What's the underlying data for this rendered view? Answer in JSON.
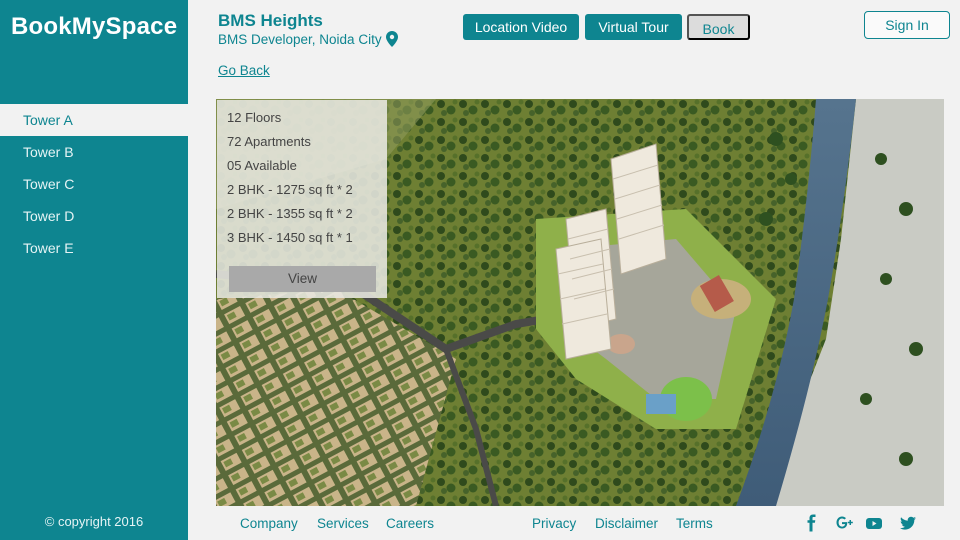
{
  "brand": "BookMySpace",
  "sidebar": {
    "items": [
      {
        "label": "Tower A"
      },
      {
        "label": "Tower B"
      },
      {
        "label": "Tower C"
      },
      {
        "label": "Tower D"
      },
      {
        "label": "Tower E"
      }
    ],
    "active_index": 0,
    "copyright": "© copyright 2016"
  },
  "header": {
    "project_name": "BMS Heights",
    "developer": "BMS Developer, Noida City",
    "location_icon": "map-pin-icon",
    "go_back": "Go Back",
    "buttons": {
      "location_video": "Location Video",
      "virtual_tour": "Virtual Tour",
      "book": "Book",
      "sign_in": "Sign In"
    }
  },
  "tower_info": {
    "floors": "12 Floors",
    "apartments": "72 Apartments",
    "available": "05 Available",
    "units": [
      "2 BHK - 1275 sq ft * 2",
      "2 BHK - 1355 sq ft * 2",
      "3 BHK - 1450 sq ft * 1"
    ],
    "view_button": "View"
  },
  "footer": {
    "left_links": [
      "Company",
      "Services",
      "Careers"
    ],
    "right_links": [
      "Privacy",
      "Disclaimer",
      "Terms"
    ],
    "social_icons": [
      "facebook-icon",
      "google-plus-icon",
      "youtube-icon",
      "twitter-icon"
    ]
  },
  "colors": {
    "brand_teal": "#0e8590",
    "background": "#f2f2f2",
    "book_button": "#dcdcdc",
    "view_button": "#a9a9a9"
  }
}
